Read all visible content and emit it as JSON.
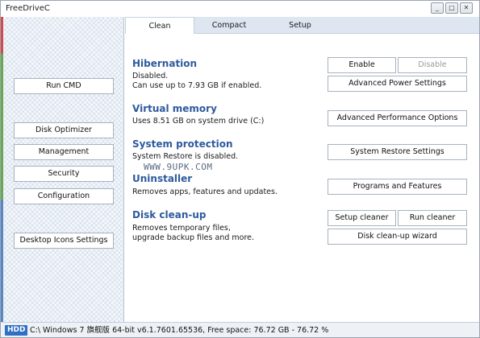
{
  "app": {
    "title": "FreeDriveC"
  },
  "window_controls": [
    "_",
    "□",
    "✕"
  ],
  "tabs": [
    {
      "label": "Clean",
      "active": true
    },
    {
      "label": "Compact",
      "active": false
    },
    {
      "label": "Setup",
      "active": false
    }
  ],
  "sidebar": {
    "run_cmd": "Run CMD",
    "disk_optimizer": "Disk Optimizer",
    "management": "Management",
    "security": "Security",
    "configuration": "Configuration",
    "desktop_icons_settings": "Desktop Icons Settings"
  },
  "sections": {
    "hibernation": {
      "title": "Hibernation",
      "line1": "Disabled.",
      "line2": "Can use up to 7.93 GB if enabled.",
      "enable_label": "Enable",
      "disable_label": "Disable",
      "advanced_label": "Advanced Power Settings"
    },
    "virtual_memory": {
      "title": "Virtual memory",
      "line1": "Uses 8.51 GB on system drive (C:)",
      "advanced_label": "Advanced Performance Options"
    },
    "system_protection": {
      "title": "System protection",
      "line1": "System Restore is disabled.",
      "settings_label": "System Restore Settings"
    },
    "uninstaller": {
      "title": "Uninstaller",
      "line1": "Removes apps, features and updates.",
      "programs_label": "Programs and Features"
    },
    "disk_cleanup": {
      "title": "Disk clean-up",
      "line1": "Removes temporary files,",
      "line2": "upgrade backup files and more.",
      "setup_label": "Setup cleaner",
      "run_label": "Run cleaner",
      "wizard_label": "Disk clean-up wizard"
    }
  },
  "watermark": "WWW.9UPK.COM",
  "status": {
    "badge": "HDD",
    "text": "C:\\ Windows 7 旗舰版  64-bit v6.1.7601.65536, Free space: 76.72 GB - 76.72 %"
  },
  "colors": {
    "section_title": "#2e5a9e",
    "tab_bar": "#dde6f1",
    "hdd_badge": "#2f6fc4"
  }
}
